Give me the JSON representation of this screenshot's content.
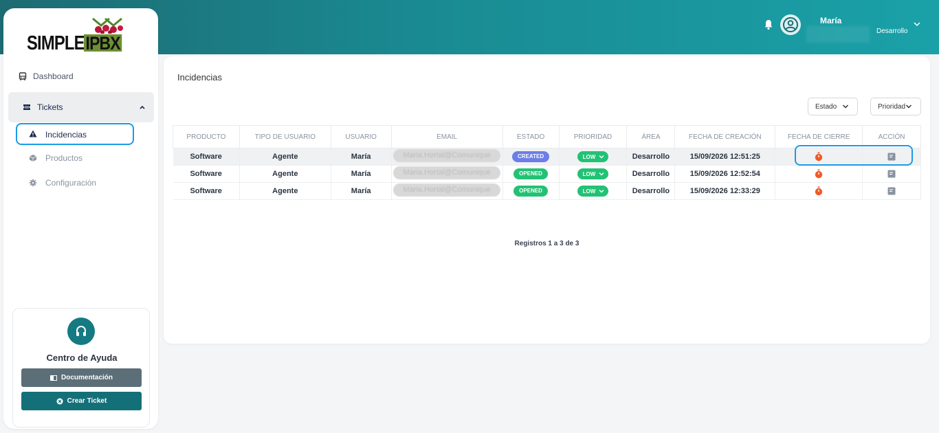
{
  "header": {
    "user_name": "María",
    "user_department": "Desarrollo"
  },
  "sidebar": {
    "logo_left": "SIMPLE",
    "logo_right": "IPBX",
    "items": [
      {
        "label": "Dashboard"
      },
      {
        "label": "Tickets"
      },
      {
        "label": "Incidencias"
      },
      {
        "label": "Productos"
      },
      {
        "label": "Configuración"
      }
    ],
    "help": {
      "title": "Centro de Ayuda",
      "doc_button": "Documentación",
      "ticket_button": "Crear Ticket"
    }
  },
  "main": {
    "title": "Incidencias",
    "filters": {
      "estado": "Estado",
      "prioridad": "Prioridad"
    },
    "columns": [
      "PRODUCTO",
      "TIPO DE USUARIO",
      "USUARIO",
      "EMAIL",
      "ESTADO",
      "PRIORIDAD",
      "ÁREA",
      "FECHA DE CREACIÓN",
      "FECHA DE CIERRE",
      "ACCIÓN"
    ],
    "rows": [
      {
        "producto": "Software",
        "tipo": "Agente",
        "usuario": "María",
        "email": "Maria.Hortal@Comunique",
        "estado": "CREATED",
        "prioridad": "LOW",
        "area": "Desarrollo",
        "fecha": "15/09/2026 12:51:25"
      },
      {
        "producto": "Software",
        "tipo": "Agente",
        "usuario": "María",
        "email": "Maria.Hortal@Comunique",
        "estado": "OPENED",
        "prioridad": "LOW",
        "area": "Desarrollo",
        "fecha": "15/09/2026 12:52:54"
      },
      {
        "producto": "Software",
        "tipo": "Agente",
        "usuario": "María",
        "email": "Maria.Hortal@Comunique",
        "estado": "OPENED",
        "prioridad": "LOW",
        "area": "Desarrollo",
        "fecha": "15/09/2026 12:33:29"
      }
    ],
    "records_text": "Registros 1 a 3 de 3"
  },
  "colors": {
    "accent": "#1a8a92",
    "created": "#6c7ee8",
    "opened": "#22c274",
    "timer": "#f05a28",
    "focus_outline": "#1a9be6"
  },
  "icons": [
    "bell-icon",
    "user-circle-icon",
    "chevron-down-icon",
    "bus-icon",
    "ticket-icon",
    "warning-icon",
    "box-icon",
    "gear-icon",
    "headset-icon",
    "book-icon",
    "close-circle-icon",
    "timer-icon",
    "document-icon"
  ]
}
